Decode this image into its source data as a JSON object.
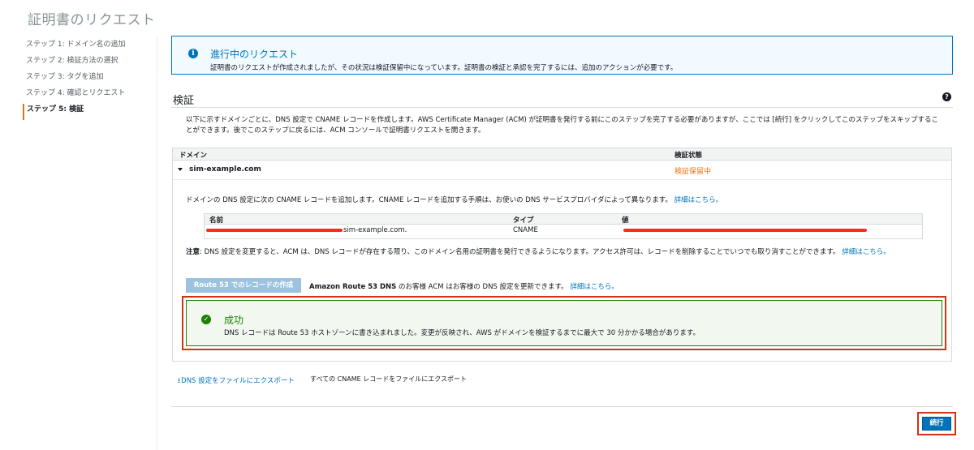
{
  "page": {
    "title": "証明書のリクエスト"
  },
  "steps": [
    {
      "label": "ステップ 1: ドメイン名の追加"
    },
    {
      "label": "ステップ 2: 検証方法の選択"
    },
    {
      "label": "ステップ 3: タグを追加"
    },
    {
      "label": "ステップ 4: 確認とリクエスト"
    },
    {
      "label": "ステップ 5: 検証"
    }
  ],
  "info": {
    "title": "進行中のリクエスト",
    "text": "証明書のリクエストが作成されましたが、その状況は検証保留中になっています。証明書の検証と承認を完了するには、追加のアクションが必要です。",
    "icon": "info-icon",
    "color": "#0073bb"
  },
  "verification": {
    "title": "検証",
    "help_icon": "?",
    "description": "以下に示すドメインごとに、DNS 設定で CNAME レコードを作成します。AWS Certificate Manager (ACM) が証明書を発行する前にこのステップを完了する必要がありますが、ここでは [続行] をクリックしてこのステップをスキップすることができます。後でこのステップに戻るには、ACM コンソールで証明書リクエストを開きます。"
  },
  "domain_table": {
    "headers": {
      "domain": "ドメイン",
      "status": "検証状態"
    },
    "row": {
      "domain": "sim-example.com",
      "status": "検証保留中",
      "status_color": "#ec7211"
    },
    "detail_text": "ドメインの DNS 設定に次の CNAME レコードを追加します。CNAME レコードを追加する手順は、お使いの DNS サービスプロバイダによって異なります。",
    "detail_link": "詳細はこちら。"
  },
  "record_table": {
    "headers": {
      "name": "名前",
      "type": "タイプ",
      "value": "値"
    },
    "row": {
      "name_suffix": "sim-example.com.",
      "type": "CNAME"
    }
  },
  "note": {
    "label": "注意",
    "text": ": DNS 設定を変更すると、ACM は、DNS レコードが存在する限り、このドメイン名用の証明書を発行できるようになります。アクセス許可は、レコードを削除することでいつでも取り消すことができます。",
    "link": "詳細はこちら。"
  },
  "route53": {
    "button_label": "Route 53 でのレコードの作成",
    "text_bold": "Amazon Route 53 DNS",
    "text": " のお客様 ACM はお客様の DNS 設定を更新できます。",
    "link": "詳細はこちら。"
  },
  "success": {
    "title": "成功",
    "text": "DNS レコードは Route 53 ホストゾーンに書き込まれました。変更が反映され、AWS がドメインを検証するまでに最大で 30 分かかる場合があります。",
    "icon": "check-circle-icon",
    "color": "#1d8102"
  },
  "export": {
    "link_label": "DNS 設定をファイルにエクスポート",
    "description": "すべての CNAME レコードをファイルにエクスポート",
    "icon": "download-icon"
  },
  "footer": {
    "continue_label": "続行"
  }
}
